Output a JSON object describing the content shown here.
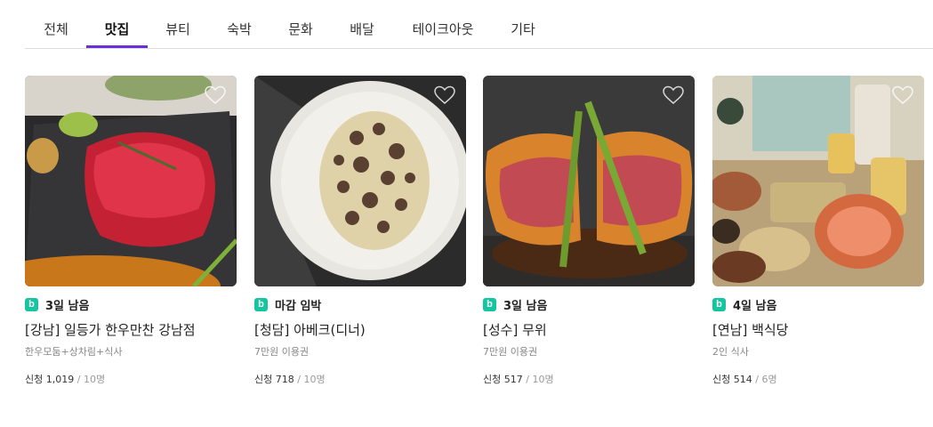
{
  "tabs": [
    {
      "label": "전체",
      "active": false
    },
    {
      "label": "맛집",
      "active": true
    },
    {
      "label": "뷰티",
      "active": false
    },
    {
      "label": "숙박",
      "active": false
    },
    {
      "label": "문화",
      "active": false
    },
    {
      "label": "배달",
      "active": false
    },
    {
      "label": "테이크아웃",
      "active": false
    },
    {
      "label": "기타",
      "active": false
    }
  ],
  "accent_color": "#6a2fd6",
  "badge_color": "#14c6a0",
  "badge_letter": "b",
  "applied_label": "신청",
  "cards": [
    {
      "deadline": "3일 남음",
      "title": "[강남] 일등가 한우만찬 강남점",
      "sub": "한우모둠+상차림+식사",
      "applied": "1,019",
      "capacity": "10명",
      "image": "raw-beef-steak-photo"
    },
    {
      "deadline": "마감 임박",
      "title": "[청담] 아베크(디너)",
      "sub": "7만원 이용권",
      "applied": "718",
      "capacity": "10명",
      "image": "truffle-pasta-photo"
    },
    {
      "deadline": "3일 남음",
      "title": "[성수] 무위",
      "sub": "7만원 이용권",
      "applied": "517",
      "capacity": "10명",
      "image": "beef-wellington-photo"
    },
    {
      "deadline": "4일 남음",
      "title": "[연남] 백식당",
      "sub": "2인 식사",
      "applied": "514",
      "capacity": "6명",
      "image": "korean-table-dishes-photo"
    }
  ]
}
